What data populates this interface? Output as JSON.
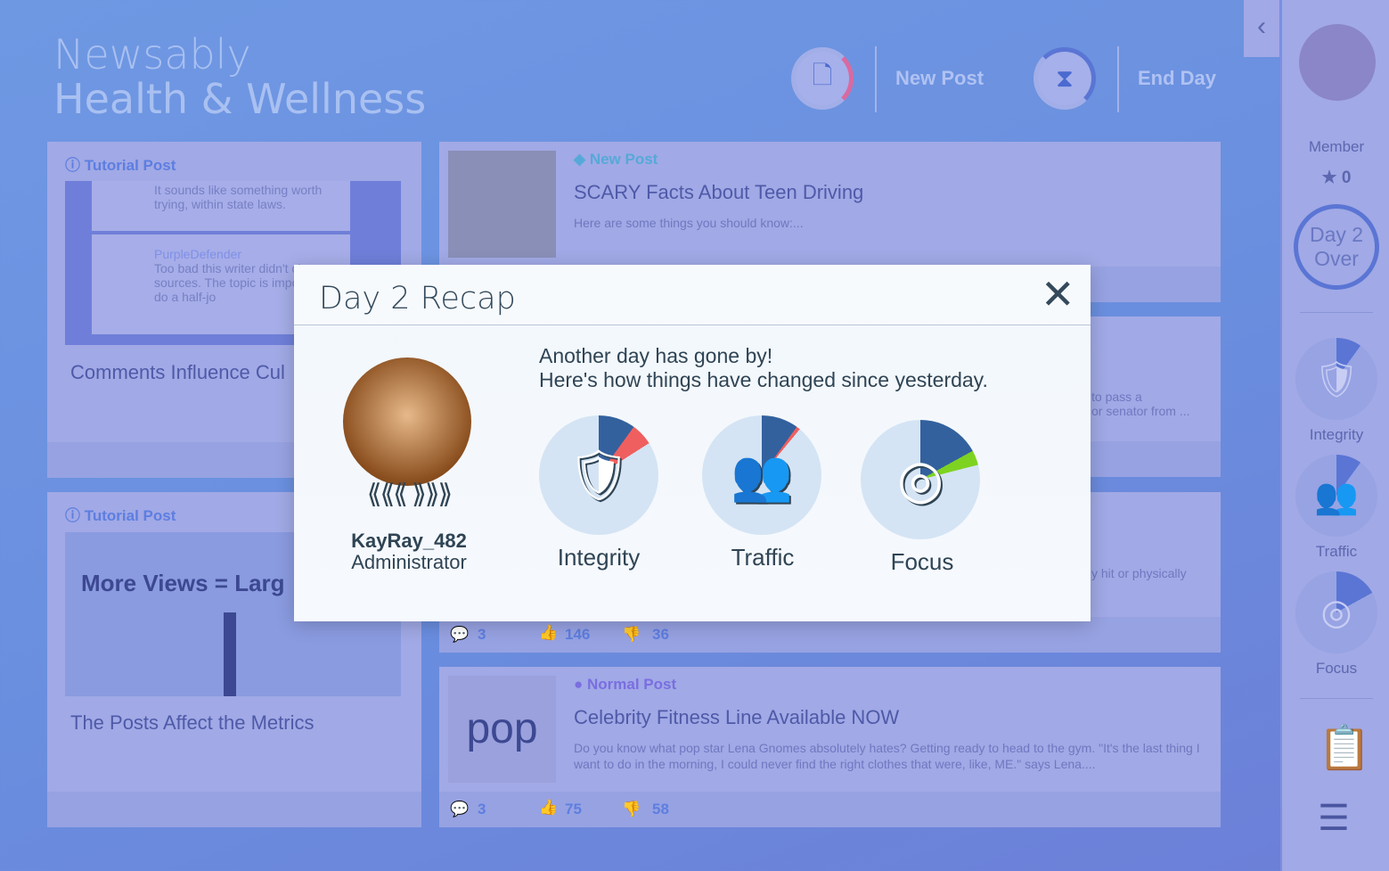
{
  "app": {
    "brand": "Newsably",
    "section": "Health & Wellness"
  },
  "header": {
    "new_post": "New Post",
    "end_day": "End Day"
  },
  "feed": {
    "left": [
      {
        "tag": "Tutorial Post",
        "title": "Comments Influence Cul",
        "comments": [
          {
            "text": "It sounds like something worth trying, within state laws."
          },
          {
            "user": "PurpleDefender",
            "text": "Too bad this writer didn't ci any sources. The topic is important to do a half-jo"
          }
        ]
      },
      {
        "tag": "Tutorial Post",
        "title": "The Posts Affect the Metrics",
        "image_text": "More Views = Larg"
      }
    ],
    "right": [
      {
        "tag": "New Post",
        "title": "SCARY Facts About Teen Driving",
        "excerpt": "Here are some things you should know:..."
      },
      {
        "excerpt": "to pass a\nor senator from ..."
      },
      {
        "excerpt": "y hit or physically",
        "comments": "3",
        "likes": "146",
        "dislikes": "36"
      },
      {
        "tag": "Normal Post",
        "title": "Celebrity Fitness Line Available NOW",
        "excerpt": "Do you know what pop star Lena Gnomes absolutely hates?  Getting ready to head to the gym. \"It's the last thing I want to do in the morning, I could never find the right clothes that were, like, ME.\" says Lena....",
        "comments": "3",
        "likes": "75",
        "dislikes": "58",
        "image_text": "pop"
      }
    ]
  },
  "sidebar": {
    "rank": "Member",
    "stars": "0",
    "day": "Day 2",
    "day_status": "Over",
    "metrics": [
      {
        "label": "Integrity",
        "value": 0.1
      },
      {
        "label": "Traffic",
        "value": 0.1
      },
      {
        "label": "Focus",
        "value": 0.17
      }
    ]
  },
  "modal": {
    "title": "Day 2 Recap",
    "line1": "Another day has gone by!",
    "line2": "Here's how things have changed since yesterday.",
    "user": "KayRay_482",
    "role": "Administrator",
    "metrics": [
      {
        "label": "Integrity",
        "value": 0.1,
        "change": 0.06,
        "change_color": "#ef5f5f"
      },
      {
        "label": "Traffic",
        "value": 0.1,
        "change": 0.01,
        "change_color": "#ef5f5f"
      },
      {
        "label": "Focus",
        "value": 0.17,
        "change": 0.04,
        "change_color": "#7ed321"
      }
    ]
  },
  "colors": {
    "pie_fill": "#33619e",
    "pie_bg": "#d4e4f4",
    "accent": "#5d7ee0"
  }
}
